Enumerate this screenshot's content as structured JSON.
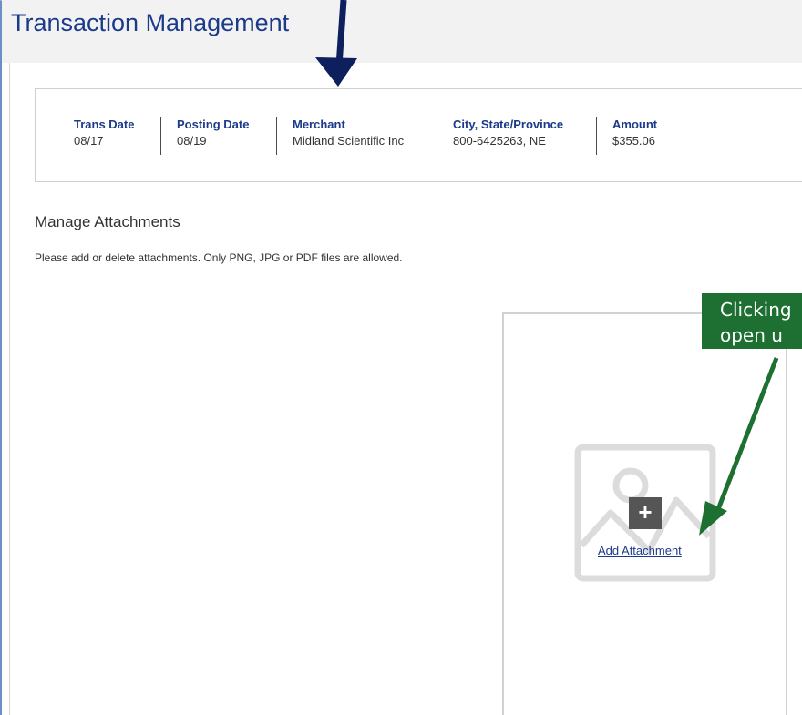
{
  "page": {
    "title": "Transaction Management"
  },
  "transaction": {
    "columns": [
      {
        "label": "Trans Date",
        "value": "08/17"
      },
      {
        "label": "Posting Date",
        "value": "08/19"
      },
      {
        "label": "Merchant",
        "value": "Midland Scientific Inc"
      },
      {
        "label": "City, State/Province",
        "value": "800-6425263, NE"
      },
      {
        "label": "Amount",
        "value": "$355.06"
      }
    ]
  },
  "attachments": {
    "heading": "Manage Attachments",
    "instructions": "Please add or delete attachments. Only PNG, JPG or PDF files are allowed.",
    "add_label": "Add Attachment",
    "plus_glyph": "+"
  },
  "annotations": {
    "callout_line1": "Clicking",
    "callout_line2": "open u",
    "callout_color": "#1e7032",
    "arrow_top_color": "#0d1f5c",
    "arrow_green_color": "#1e7032"
  },
  "colors": {
    "title": "#1b3a8a",
    "label": "#1b3a8a",
    "header_bg": "#f2f2f2"
  }
}
